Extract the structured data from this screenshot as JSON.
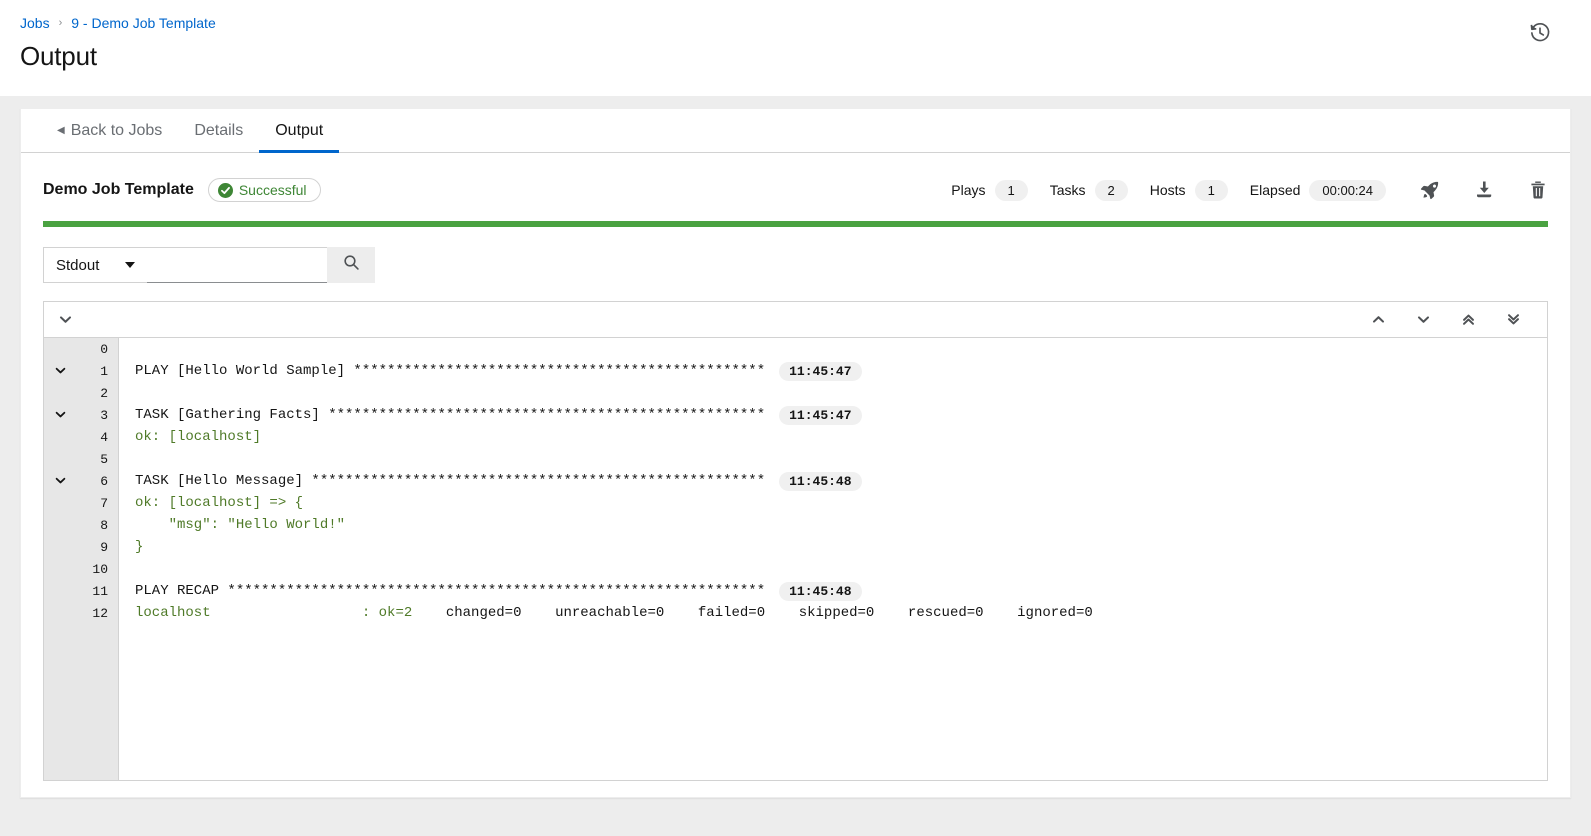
{
  "header": {
    "breadcrumb": [
      {
        "label": "Jobs",
        "link": true
      },
      {
        "label": "9 - Demo Job Template",
        "link": true
      }
    ],
    "separator": "›",
    "title": "Output",
    "history_icon": "history-icon"
  },
  "tabs": [
    {
      "label": "Back to Jobs",
      "active": false,
      "back": true
    },
    {
      "label": "Details",
      "active": false
    },
    {
      "label": "Output",
      "active": true
    }
  ],
  "job": {
    "name": "Demo Job Template",
    "status": "Successful",
    "status_color": "#3e8635",
    "progress_color": "#4aa241",
    "stats": [
      {
        "label": "Plays",
        "value": "1"
      },
      {
        "label": "Tasks",
        "value": "2"
      },
      {
        "label": "Hosts",
        "value": "1"
      },
      {
        "label": "Elapsed",
        "value": "00:00:24"
      }
    ],
    "actions": [
      {
        "name": "relaunch-icon",
        "title": "Relaunch"
      },
      {
        "name": "download-icon",
        "title": "Download"
      },
      {
        "name": "delete-icon",
        "title": "Delete"
      }
    ]
  },
  "search": {
    "select_value": "Stdout",
    "input_value": "",
    "placeholder": "",
    "button_icon": "search-icon"
  },
  "output_toolbar": {
    "collapse_all_icon": "chevron-down-icon",
    "nav_icons": [
      {
        "name": "scroll-previous-icon",
        "glyph": "chevron-up"
      },
      {
        "name": "scroll-next-icon",
        "glyph": "chevron-down"
      },
      {
        "name": "scroll-first-icon",
        "glyph": "double-chevron-up"
      },
      {
        "name": "scroll-last-icon",
        "glyph": "double-chevron-down"
      }
    ]
  },
  "output_lines": [
    {
      "num": "0",
      "collapsible": false,
      "text": "",
      "color": "dark",
      "timestamp": ""
    },
    {
      "num": "1",
      "collapsible": true,
      "text": "PLAY [Hello World Sample] *************************************************",
      "color": "dark",
      "timestamp": "11:45:47"
    },
    {
      "num": "2",
      "collapsible": false,
      "text": "",
      "color": "dark",
      "timestamp": ""
    },
    {
      "num": "3",
      "collapsible": true,
      "text": "TASK [Gathering Facts] ****************************************************",
      "color": "dark",
      "timestamp": "11:45:47"
    },
    {
      "num": "4",
      "collapsible": false,
      "text": "ok: [localhost]",
      "color": "green",
      "timestamp": ""
    },
    {
      "num": "5",
      "collapsible": false,
      "text": "",
      "color": "dark",
      "timestamp": ""
    },
    {
      "num": "6",
      "collapsible": true,
      "text": "TASK [Hello Message] ******************************************************",
      "color": "dark",
      "timestamp": "11:45:48"
    },
    {
      "num": "7",
      "collapsible": false,
      "text": "ok: [localhost] => {",
      "color": "green",
      "timestamp": ""
    },
    {
      "num": "8",
      "collapsible": false,
      "text": "    \"msg\": \"Hello World!\"",
      "color": "green",
      "timestamp": ""
    },
    {
      "num": "9",
      "collapsible": false,
      "text": "}",
      "color": "green",
      "timestamp": ""
    },
    {
      "num": "10",
      "collapsible": false,
      "text": "",
      "color": "dark",
      "timestamp": ""
    },
    {
      "num": "11",
      "collapsible": false,
      "text": "PLAY RECAP ****************************************************************",
      "color": "dark",
      "timestamp": "11:45:48"
    },
    {
      "num": "12",
      "collapsible": false,
      "text": "localhost                  : ok=2    changed=0    unreachable=0    failed=0    skipped=0    rescued=0    ignored=0",
      "color": "recap",
      "timestamp": ""
    }
  ],
  "recap": {
    "host": "localhost",
    "ok": "ok=2",
    "rest": "changed=0    unreachable=0    failed=0    skipped=0    rescued=0    ignored=0"
  }
}
